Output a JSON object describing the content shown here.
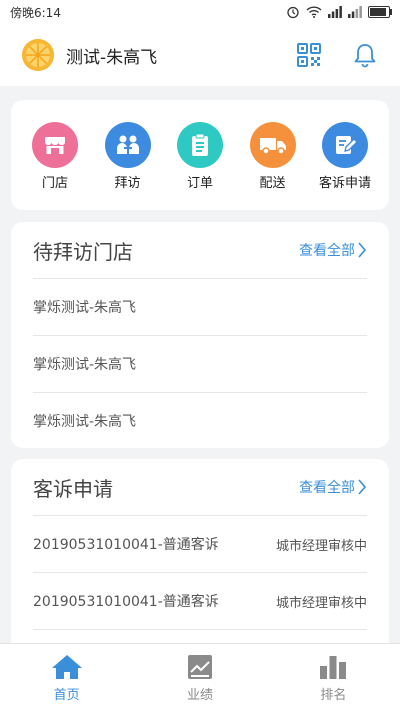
{
  "status_bar": {
    "time": "傍晚6:14",
    "battery_level": 0.9
  },
  "header": {
    "title": "测试-朱高飞"
  },
  "quick_menu": [
    {
      "label": "门店",
      "icon": "store-icon",
      "color": "#ee6f98"
    },
    {
      "label": "拜访",
      "icon": "people-icon",
      "color": "#3d8be0"
    },
    {
      "label": "订单",
      "icon": "clipboard-icon",
      "color": "#2ec9c2"
    },
    {
      "label": "配送",
      "icon": "truck-icon",
      "color": "#f5913c"
    },
    {
      "label": "客诉申请",
      "icon": "edit-document-icon",
      "color": "#3d8be0"
    }
  ],
  "pending_visits": {
    "title": "待拜访门店",
    "view_all": "查看全部",
    "items": [
      "掌烁测试-朱高飞",
      "掌烁测试-朱高飞",
      "掌烁测试-朱高飞"
    ]
  },
  "complaints": {
    "title": "客诉申请",
    "view_all": "查看全部",
    "items": [
      {
        "name": "20190531010041-普通客诉",
        "status": "城市经理审核中"
      },
      {
        "name": "20190531010041-普通客诉",
        "status": "城市经理审核中"
      }
    ]
  },
  "tabs": [
    {
      "label": "首页",
      "icon": "home-icon",
      "active": true
    },
    {
      "label": "业绩",
      "icon": "chart-icon",
      "active": false
    },
    {
      "label": "排名",
      "icon": "ranking-icon",
      "active": false
    }
  ],
  "colors": {
    "accent": "#3b8fd9",
    "inactive": "#8a8a8a"
  }
}
